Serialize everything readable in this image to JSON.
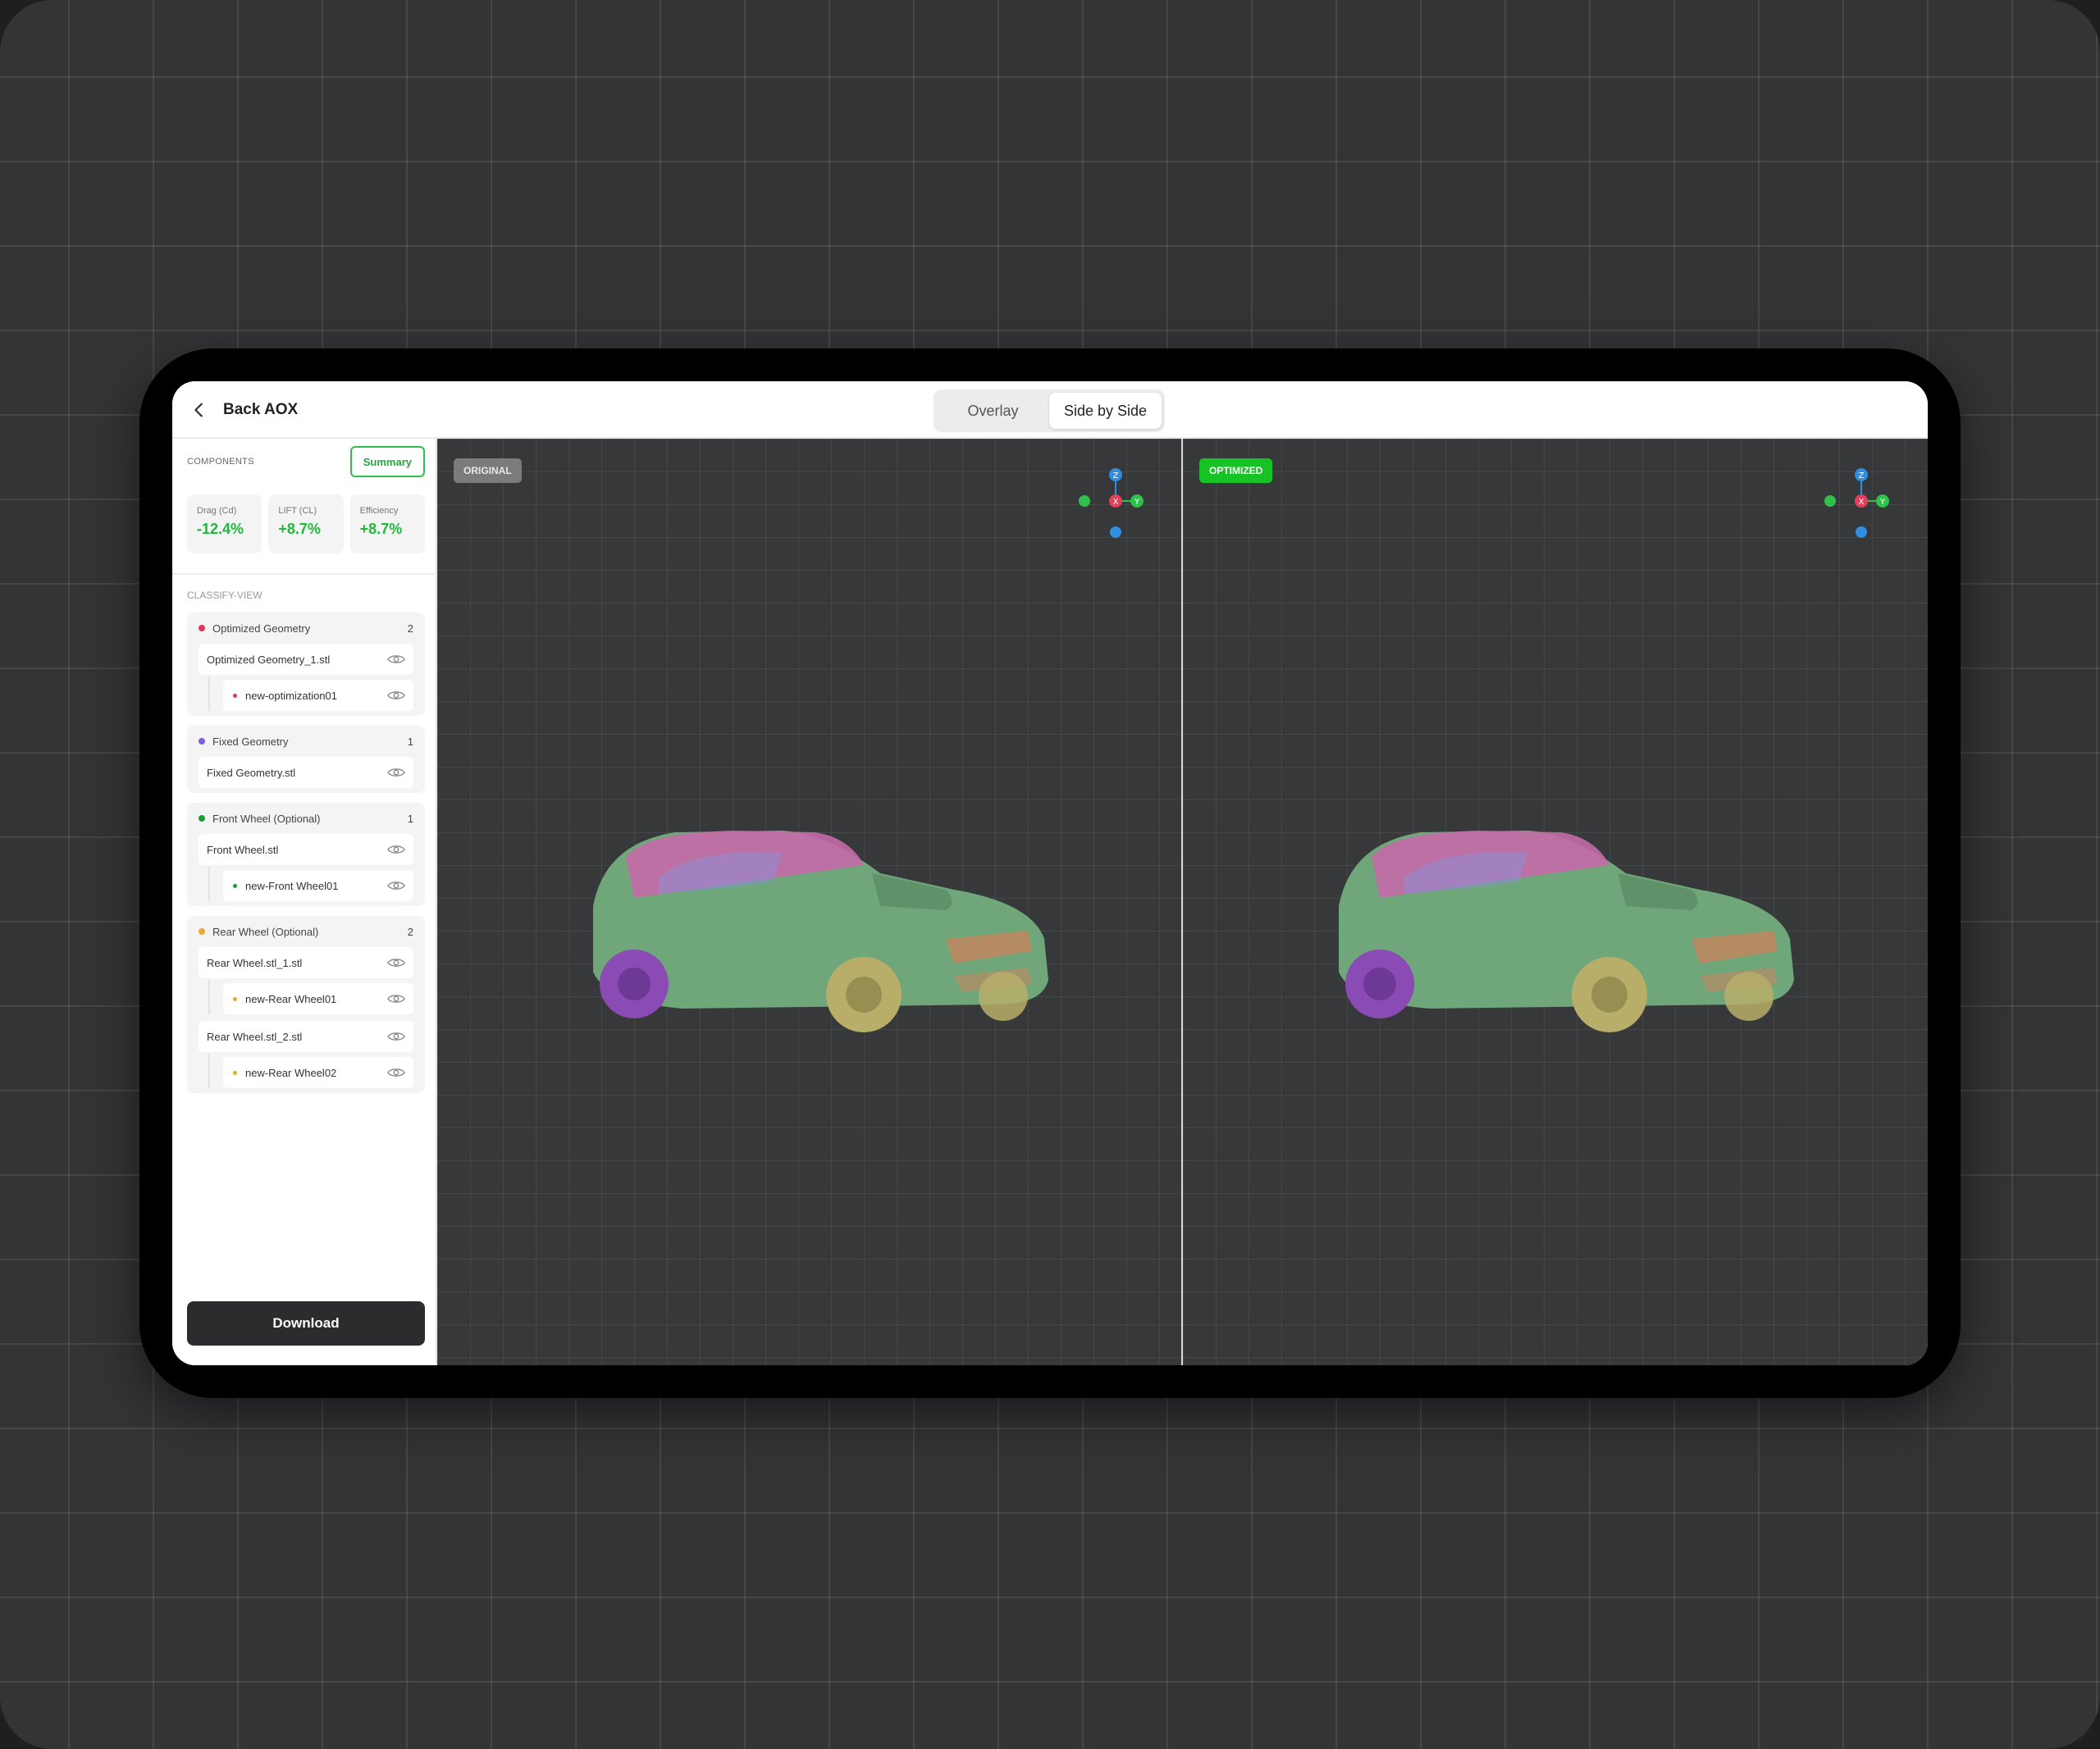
{
  "header": {
    "back_label": "Back AOX",
    "view_modes": [
      {
        "label": "Overlay",
        "active": false
      },
      {
        "label": "Side by Side",
        "active": true
      }
    ]
  },
  "sidebar": {
    "components_label": "COMPONENTS",
    "summary_label": "Summary",
    "metrics": [
      {
        "label": "Drag (Cd)",
        "value": "-12.4%"
      },
      {
        "label": "LIFT (CL)",
        "value": "+8.7%"
      },
      {
        "label": "Efficiency",
        "value": "+8.7%"
      }
    ],
    "classify_label": "CLASSIFY-VIEW",
    "groups": [
      {
        "name": "Optimized Geometry",
        "count": "2",
        "color": "#e0385a",
        "files": [
          {
            "name": "Optimized Geometry_1.stl",
            "children": [
              {
                "name": "new-optimization01",
                "color": "#e0385a"
              }
            ]
          }
        ]
      },
      {
        "name": "Fixed Geometry",
        "count": "1",
        "color": "#7b5fd6",
        "files": [
          {
            "name": "Fixed Geometry.stl",
            "children": []
          }
        ]
      },
      {
        "name": "Front Wheel (Optional)",
        "count": "1",
        "color": "#1f9a3a",
        "files": [
          {
            "name": "Front Wheel.stl",
            "children": [
              {
                "name": "new-Front Wheel01",
                "color": "#1f9a3a"
              }
            ]
          }
        ]
      },
      {
        "name": "Rear Wheel (Optional)",
        "count": "2",
        "color": "#f0a830",
        "files": [
          {
            "name": "Rear Wheel.stl_1.stl",
            "children": [
              {
                "name": "new-Rear Wheel01",
                "color": "#f0a830"
              }
            ]
          },
          {
            "name": "Rear Wheel.stl_2.stl",
            "children": [
              {
                "name": "new-Rear Wheel02",
                "color": "#f0a830"
              }
            ]
          }
        ]
      }
    ],
    "download_label": "Download"
  },
  "viewports": {
    "original_label": "ORIGINAL",
    "optimized_label": "OPTIMIZED",
    "axes": {
      "z": "Z",
      "x": "X",
      "y": "Y"
    }
  },
  "colors": {
    "accent_green": "#1fb83a",
    "body_green": "#6fa77a",
    "roof_pink": "#c46aa8",
    "wheel_purple": "#8a4bb5",
    "wheel_yellow": "#b8ae6a"
  }
}
